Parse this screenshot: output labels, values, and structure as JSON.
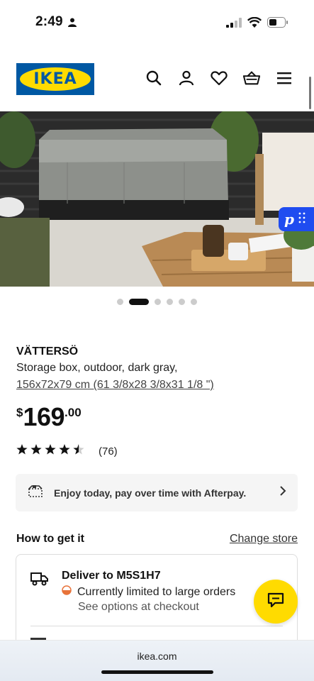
{
  "status_bar": {
    "time": "2:49"
  },
  "header": {
    "logo_text": "IKEA",
    "icons": [
      "search-icon",
      "account-icon",
      "wishlist-heart-icon",
      "basket-icon",
      "menu-icon"
    ]
  },
  "carousel": {
    "total_slides": 6,
    "active_index": 1
  },
  "product": {
    "name": "VÄTTERSÖ",
    "description": "Storage box, outdoor, dark gray,",
    "size": "156x72x79 cm (61 3/8x28 3/8x31 1/8 \")",
    "price_currency": "$",
    "price_main": "169",
    "price_cents": ".00",
    "rating_stars": 4.5,
    "review_count": "(76)"
  },
  "afterpay": {
    "text": "Enjoy today, pay over time with Afterpay."
  },
  "fulfillment": {
    "title": "How to get it",
    "change_store": "Change store",
    "deliver_title": "Deliver to M5S1H7",
    "limited_text": "Currently limited to large orders",
    "see_options": "See options at checkout",
    "status_color": "#e8733a"
  },
  "browser": {
    "url": "ikea.com"
  },
  "colors": {
    "ikea_blue": "#0058a3",
    "ikea_yellow": "#ffdb00",
    "badge_blue": "#1f4cf0"
  }
}
